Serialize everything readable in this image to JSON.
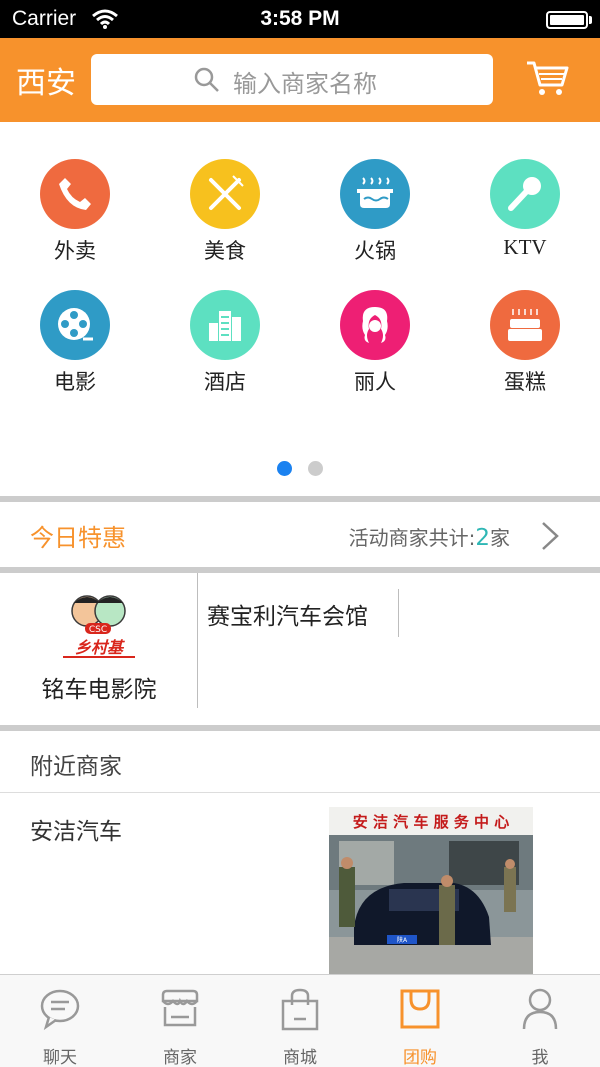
{
  "status_bar": {
    "carrier": "Carrier",
    "time": "3:58 PM"
  },
  "header": {
    "city": "西安",
    "search_placeholder": "输入商家名称"
  },
  "categories": [
    {
      "label": "外卖",
      "icon": "phone-icon",
      "color": "#ef6a3f"
    },
    {
      "label": "美食",
      "icon": "fork-knife-icon",
      "color": "#f7c11e"
    },
    {
      "label": "火锅",
      "icon": "hotpot-icon",
      "color": "#2f9bc6"
    },
    {
      "label": "KTV",
      "icon": "microphone-icon",
      "color": "#5de0c1"
    },
    {
      "label": "电影",
      "icon": "film-reel-icon",
      "color": "#2f9bc6"
    },
    {
      "label": "酒店",
      "icon": "building-icon",
      "color": "#5de0c1"
    },
    {
      "label": "丽人",
      "icon": "woman-face-icon",
      "color": "#ee1f74"
    },
    {
      "label": "蛋糕",
      "icon": "cake-icon",
      "color": "#ef6a3f"
    }
  ],
  "pager": {
    "pages": 2,
    "current": 1
  },
  "deals": {
    "title": "今日特惠",
    "count_label": "活动商家共计:",
    "count_value": "2",
    "count_unit": "家"
  },
  "merchants": [
    {
      "name": "铭车电影院",
      "logo_text": "乡村基",
      "logo_badge": "CSC"
    },
    {
      "name": "赛宝利汽车会馆"
    }
  ],
  "nearby": {
    "title": "附近商家",
    "items": [
      {
        "name": "安洁汽车",
        "photo_sign": "安 洁 汽 车 服 务 中 心"
      }
    ]
  },
  "tabs": [
    {
      "label": "聊天",
      "icon": "chat-icon",
      "active": false
    },
    {
      "label": "商家",
      "icon": "store-icon",
      "active": false
    },
    {
      "label": "商城",
      "icon": "shopping-bag-icon",
      "active": false
    },
    {
      "label": "团购",
      "icon": "group-buy-bag-icon",
      "active": true
    },
    {
      "label": "我",
      "icon": "person-icon",
      "active": false
    }
  ],
  "colors": {
    "brand": "#f7922c",
    "active_dot": "#1b82f0",
    "count_accent": "#2fb7b5"
  }
}
